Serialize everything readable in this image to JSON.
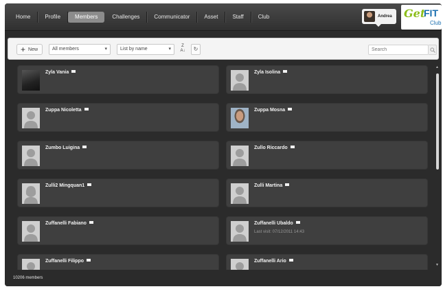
{
  "nav": {
    "items": [
      {
        "label": "Home"
      },
      {
        "label": "Profile"
      },
      {
        "label": "Members",
        "active": true
      },
      {
        "label": "Challenges"
      },
      {
        "label": "Communicator"
      },
      {
        "label": "Asset"
      },
      {
        "label": "Staff"
      },
      {
        "label": "Club"
      }
    ],
    "user_name": "Andrea"
  },
  "logo": {
    "get": "Get",
    "fit": "FIT",
    "club": "Club"
  },
  "toolbar": {
    "new_label": "New",
    "filter_value": "All members",
    "sort_value": "List by name",
    "search_placeholder": "Search"
  },
  "members": [
    {
      "name": "Zyla Vania",
      "avatar": "tablets"
    },
    {
      "name": "Zyla Isolina",
      "avatar": "generic"
    },
    {
      "name": "Zuppa Nicoletta",
      "avatar": "generic"
    },
    {
      "name": "Zuppa Mosna",
      "avatar": "photo"
    },
    {
      "name": "Zumbo Luigina",
      "avatar": "generic"
    },
    {
      "name": "Zullo Riccardo",
      "avatar": "generic"
    },
    {
      "name": "Zulli2 Mingquan1",
      "avatar": "female"
    },
    {
      "name": "Zulli Martina",
      "avatar": "generic"
    },
    {
      "name": "Zuffanelli Fabiano",
      "avatar": "generic"
    },
    {
      "name": "Zuffanelli Ubaldo",
      "avatar": "generic",
      "last_visit": "Last visit: 07/12/2011 14:43"
    },
    {
      "name": "Zuffanelli Filippo",
      "avatar": "generic"
    },
    {
      "name": "Zuffanelli Ario",
      "avatar": "generic"
    }
  ],
  "footer": {
    "count": "10206 members"
  },
  "colors": {
    "nav_active": "#8c8c8c",
    "card_bg": "#3f3f3f",
    "logo_green": "#8bbd1a",
    "logo_blue": "#1a6fb0"
  }
}
